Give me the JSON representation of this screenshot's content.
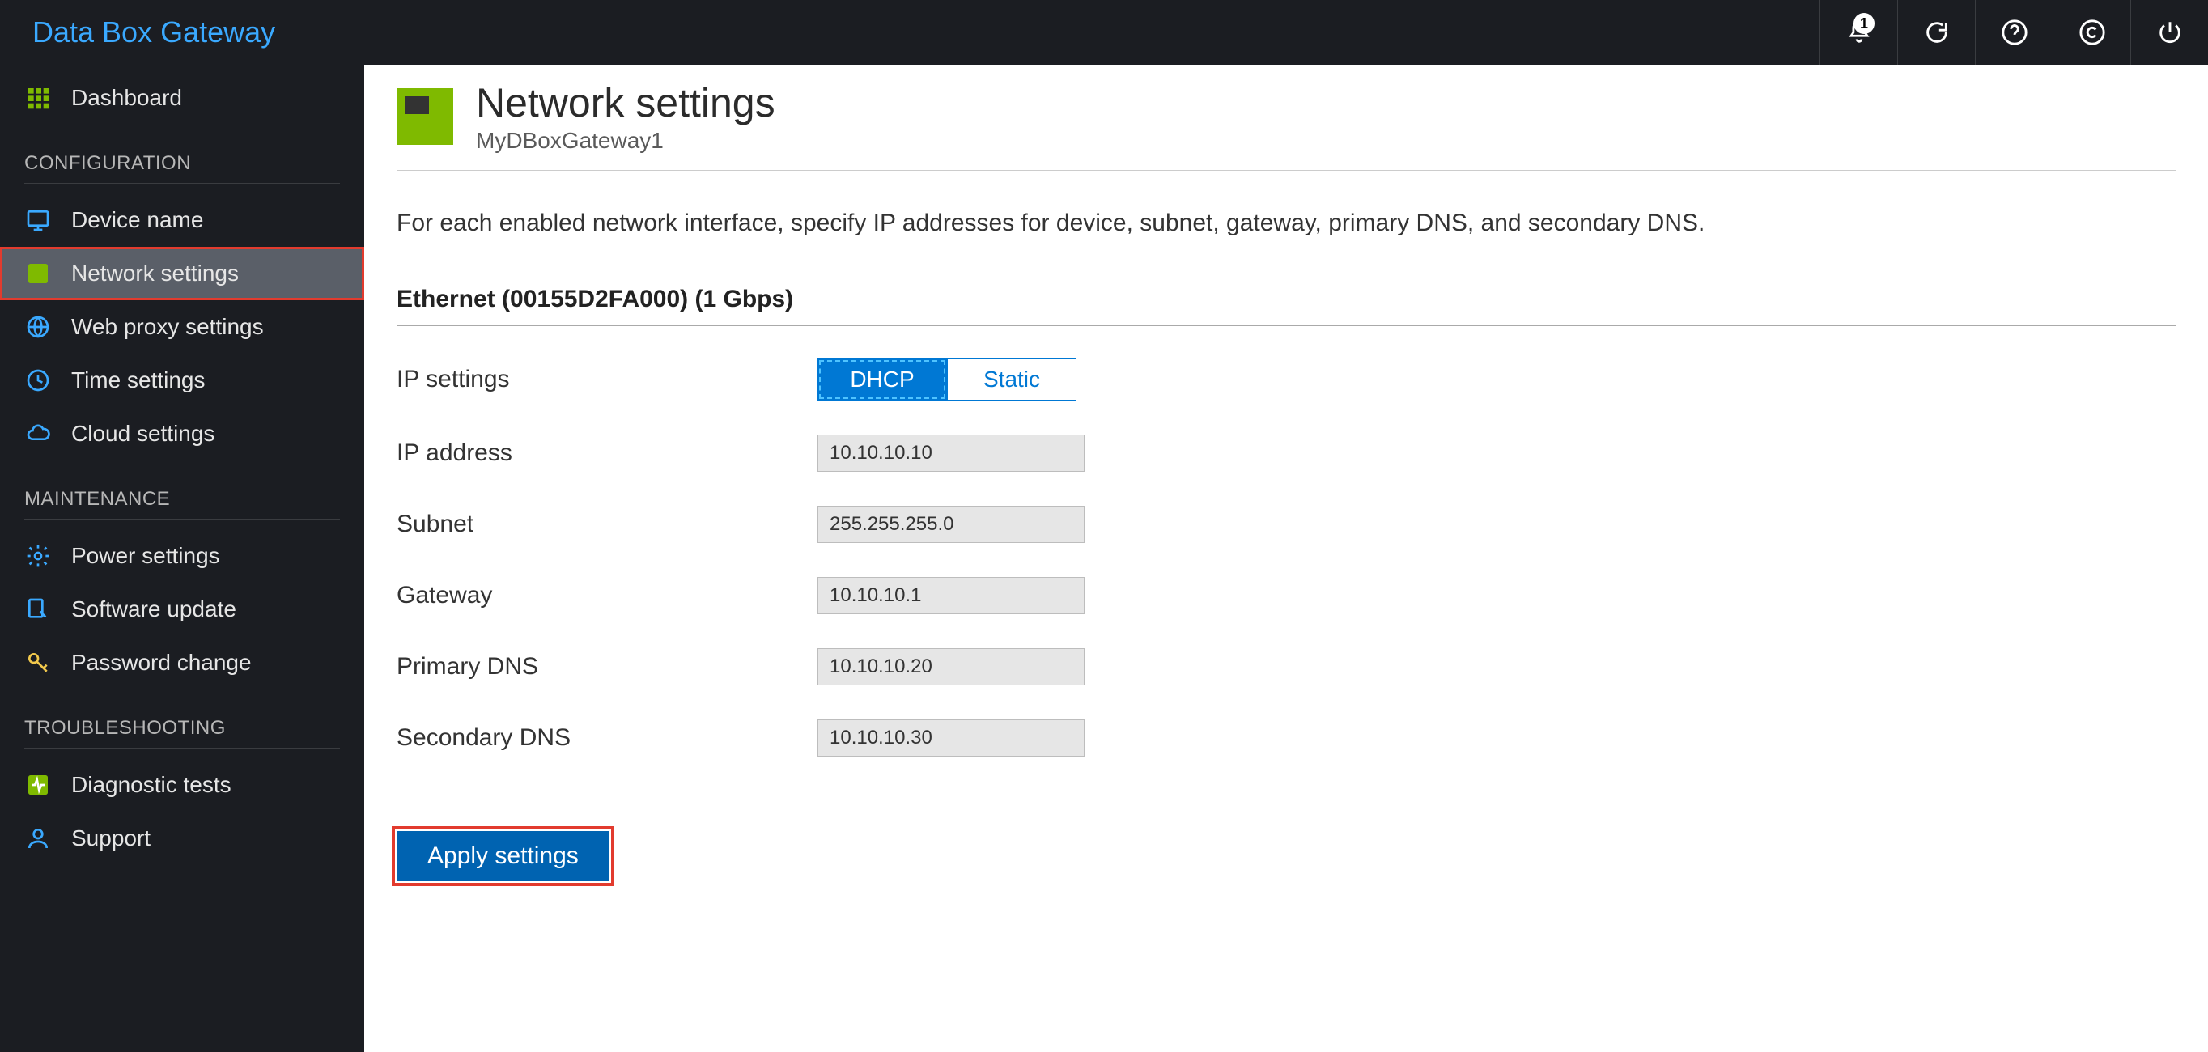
{
  "brand": "Data Box Gateway",
  "topbar": {
    "notification_count": "1"
  },
  "sidebar": {
    "dashboard": "Dashboard",
    "section_config": "CONFIGURATION",
    "device_name": "Device name",
    "network_settings": "Network settings",
    "web_proxy": "Web proxy settings",
    "time_settings": "Time settings",
    "cloud_settings": "Cloud settings",
    "section_maint": "MAINTENANCE",
    "power_settings": "Power settings",
    "software_update": "Software update",
    "password_change": "Password change",
    "section_trouble": "TROUBLESHOOTING",
    "diagnostic_tests": "Diagnostic tests",
    "support": "Support"
  },
  "page": {
    "title": "Network settings",
    "subtitle": "MyDBoxGateway1",
    "description": "For each enabled network interface, specify IP addresses for device, subnet, gateway, primary DNS, and secondary DNS.",
    "interface_heading": "Ethernet (00155D2FA000) (1 Gbps)",
    "labels": {
      "ip_settings": "IP settings",
      "ip_address": "IP address",
      "subnet": "Subnet",
      "gateway": "Gateway",
      "primary_dns": "Primary DNS",
      "secondary_dns": "Secondary DNS"
    },
    "toggle": {
      "dhcp": "DHCP",
      "static": "Static"
    },
    "values": {
      "ip_address": "10.10.10.10",
      "subnet": "255.255.255.0",
      "gateway": "10.10.10.1",
      "primary_dns": "10.10.10.20",
      "secondary_dns": "10.10.10.30"
    },
    "apply_button": "Apply settings"
  }
}
